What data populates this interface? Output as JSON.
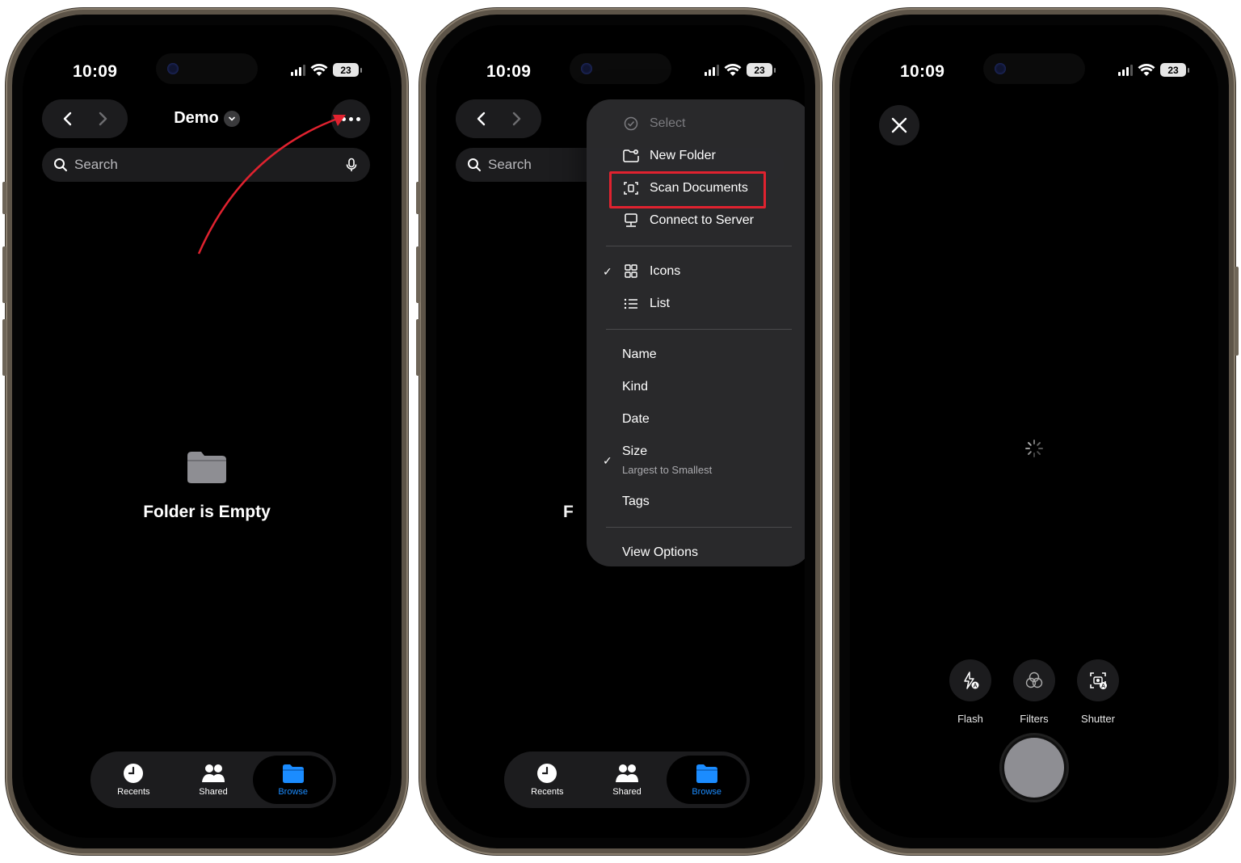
{
  "status": {
    "time": "10:09",
    "battery": "23"
  },
  "panel1": {
    "folder_title": "Demo",
    "search_placeholder": "Search",
    "empty_message": "Folder is Empty"
  },
  "panel2": {
    "search_placeholder": "Search",
    "partial_text": "F",
    "menu": {
      "select": "Select",
      "new_folder": "New Folder",
      "scan_documents": "Scan Documents",
      "connect_to_server": "Connect to Server",
      "icons": "Icons",
      "list": "List",
      "name": "Name",
      "kind": "Kind",
      "date": "Date",
      "size": "Size",
      "size_sub": "Largest to Smallest",
      "tags": "Tags",
      "view_options": "View Options"
    },
    "highlight_color": "#e0222f"
  },
  "tabs": {
    "recents": "Recents",
    "shared": "Shared",
    "browse": "Browse"
  },
  "camera": {
    "flash": "Flash",
    "filters": "Filters",
    "shutter": "Shutter"
  },
  "colors": {
    "accent": "#1b8cff",
    "arrow": "#e0222f"
  }
}
